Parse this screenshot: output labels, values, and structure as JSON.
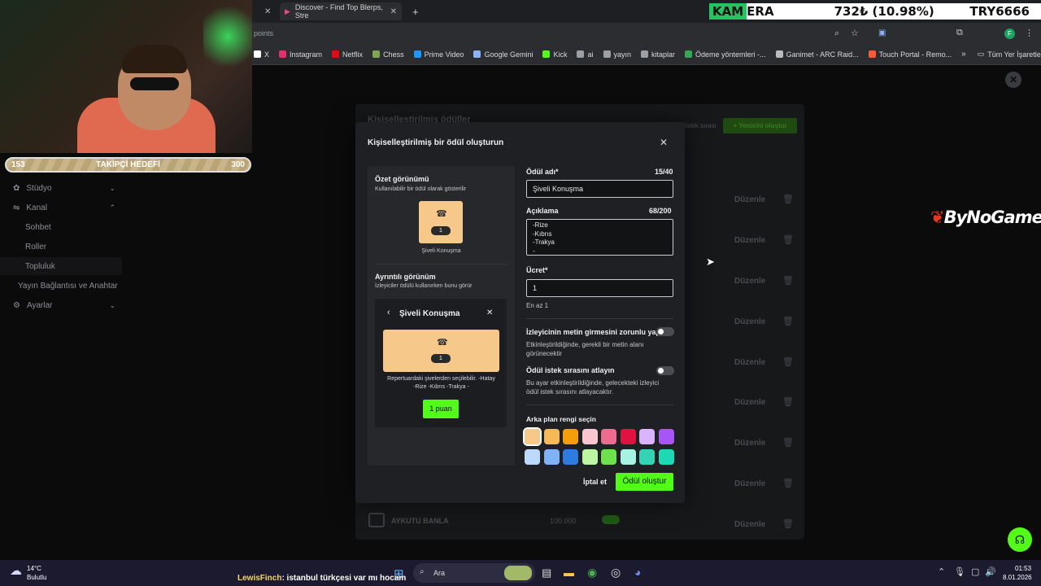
{
  "browser": {
    "tabs": [
      {
        "label": "Discover - Find Top Blerps, Stre"
      },
      {
        "label": "+"
      }
    ],
    "url_fragment": "points",
    "bookmarks": [
      {
        "label": "X",
        "color": "#ffffff"
      },
      {
        "label": "Instagram",
        "color": "#e1306c"
      },
      {
        "label": "Netflix",
        "color": "#e50914"
      },
      {
        "label": "Chess",
        "color": "#7fa650"
      },
      {
        "label": "Prime Video",
        "color": "#1a98ff"
      },
      {
        "label": "Google Gemini",
        "color": "#8ab4f8"
      },
      {
        "label": "Kick",
        "color": "#53fc18"
      },
      {
        "label": "ai",
        "color": "#9aa0a6"
      },
      {
        "label": "yayın",
        "color": "#9aa0a6"
      },
      {
        "label": "kitaplar",
        "color": "#9aa0a6"
      },
      {
        "label": "Ödeme yöntemleri -...",
        "color": "#34a853"
      },
      {
        "label": "Ganimet - ARC Raid...",
        "color": "#bbbbbb"
      },
      {
        "label": "Touch Portal - Remo...",
        "color": "#ff5a36"
      }
    ],
    "all_bookmarks": "Tüm Yer İşaretleri"
  },
  "ticker": {
    "highlight": "KAM",
    "rest": "ERA",
    "price": "732₺ (10.98%)",
    "pair": "TRY6666"
  },
  "follower_goal": {
    "current": "153",
    "label": "TAKİPÇİ HEDEFİ",
    "target": "300",
    "progress": 0.51
  },
  "sidebar": {
    "items": [
      {
        "label": "Stüdyo"
      },
      {
        "label": "Kanal"
      },
      {
        "label": "Sohbet"
      },
      {
        "label": "Roller"
      },
      {
        "label": "Topluluk"
      },
      {
        "label": "Yayın Bağlantısı ve Anahtar"
      },
      {
        "label": "Ayarlar"
      }
    ]
  },
  "background_page": {
    "title": "Kişiselleştirilmiş ödüller",
    "queue_label": "İstek sırası",
    "new_button": "+ Yenisini oluştur",
    "edit_label": "Düzenle",
    "last_row": {
      "name": "AYKUTU BANLA",
      "cost": "100.000"
    }
  },
  "modal": {
    "title": "Kişiselleştirilmiş bir ödül oluşturun",
    "summary_title": "Özet görünümü",
    "summary_sub": "Kullanılabilir bir ödül olarak gösterilir",
    "reward_name": "Şiveli Konuşma",
    "count": "1",
    "detail_title": "Ayrıntılı görünüm",
    "detail_sub": "İzleyiciler ödülü kullanırken bunu görür",
    "detail_desc": "Repertuardaki şivelerden seçilebilir. -Hatay -Rize -Kıbrıs -Trakya -",
    "detail_button": "1 puan",
    "name_label": "Ödül adı*",
    "name_counter": "15/40",
    "name_value": "Şiveli Konuşma",
    "desc_label": "Açıklama",
    "desc_counter": "68/200",
    "desc_lines": [
      "-Rize",
      "-Kıbrıs",
      "-Trakya",
      "-"
    ],
    "cost_label": "Ücret*",
    "cost_value": "1",
    "cost_hint": "En az 1",
    "toggle1_label": "İzleyicinin metin girmesini zorunlu yap",
    "toggle1_desc": "Etkinleştirildiğinde, gerekli bir metin alanı görünecektir",
    "toggle2_label": "Ödül istek sırasını atlayın",
    "toggle2_desc": "Bu ayar etkinleştirildiğinde, gelecekteki izleyici ödül istek sırasını atlayacaktır.",
    "bg_color_label": "Arka plan rengi seçin",
    "swatches_row1": [
      "#f6c98b",
      "#f7b955",
      "#f59e0b",
      "#f9c5cf",
      "#ec6b8f",
      "#e0123f",
      "#d8b4fe",
      "#a855f7"
    ],
    "swatches_row2": [
      "#bcd8fb",
      "#7fb3f5",
      "#2f7be0",
      "#bef5a2",
      "#6ee14e",
      "#a7f3e3",
      "#34d3b4",
      "#1fd8b4"
    ],
    "cancel": "İptal et",
    "create": "Ödül oluştur"
  },
  "brand": "ByNoGame",
  "taskbar": {
    "weather_temp": "14°C",
    "weather_desc": "Bulutlu",
    "chat_user": "LewisFinch",
    "chat_text": ": istanbul türkçesi var mı hocam",
    "search_placeholder": "Ara",
    "time": "01:53",
    "date": "8.01.2026"
  },
  "colors": {
    "accent": "#53fc18",
    "modal_bg": "#1f2023"
  }
}
